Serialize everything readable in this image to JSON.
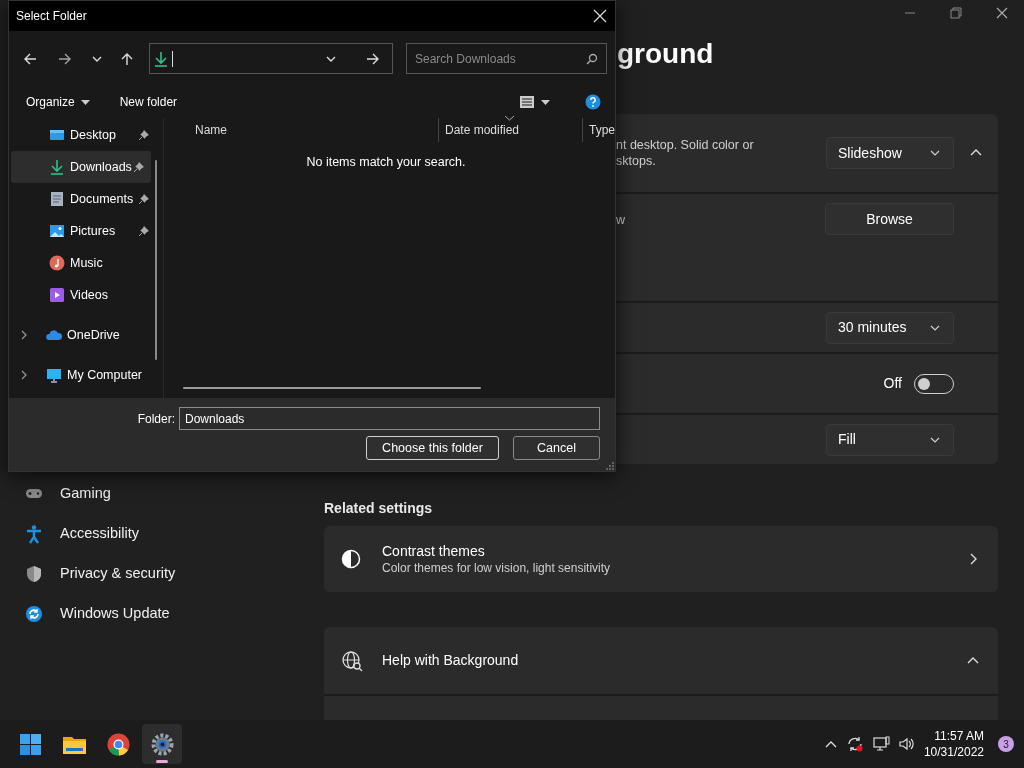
{
  "settings": {
    "heading": "ground",
    "sidebar": [
      {
        "label": "Gaming"
      },
      {
        "label": "Accessibility"
      },
      {
        "label": "Privacy & security"
      },
      {
        "label": "Windows Update"
      }
    ],
    "background_card": {
      "rows": [
        {
          "kind": "dropdown",
          "description_lines": [
            "nt desktop. Solid color or",
            "sktops."
          ],
          "value": "Slideshow",
          "expanded": true
        },
        {
          "kind": "button",
          "description_lines": [
            "w"
          ],
          "value": "Browse"
        },
        {
          "kind": "dropdown",
          "value": "30 minutes"
        },
        {
          "kind": "toggle",
          "on": false,
          "value": "Off"
        },
        {
          "kind": "dropdown",
          "value": "Fill"
        }
      ]
    },
    "related_settings": {
      "title": "Related settings",
      "items": [
        {
          "title": "Contrast themes",
          "subtitle": "Color themes for low vision, light sensitivity"
        }
      ]
    },
    "help": {
      "title": "Help with Background",
      "expanded": true
    }
  },
  "dialog": {
    "title": "Select Folder",
    "search": {
      "placeholder": "Search Downloads"
    },
    "commands": [
      "Organize",
      "New folder"
    ],
    "nav": [
      {
        "label": "Desktop",
        "kind": "quick",
        "pinned": true,
        "selected": false
      },
      {
        "label": "Downloads",
        "kind": "quick",
        "pinned": true,
        "selected": true
      },
      {
        "label": "Documents",
        "kind": "quick",
        "pinned": true,
        "selected": false
      },
      {
        "label": "Pictures",
        "kind": "quick",
        "pinned": true,
        "selected": false
      },
      {
        "label": "Music",
        "kind": "quick",
        "pinned": false,
        "selected": false
      },
      {
        "label": "Videos",
        "kind": "quick",
        "pinned": false,
        "selected": false
      },
      {
        "label": "OneDrive",
        "kind": "location",
        "pinned": false,
        "selected": false
      },
      {
        "label": "My Computer",
        "kind": "location",
        "pinned": false,
        "selected": false
      }
    ],
    "columns": [
      {
        "label": "Name",
        "sorted": false
      },
      {
        "label": "Date modified",
        "sorted": true
      },
      {
        "label": "Type",
        "sorted": false
      }
    ],
    "empty_message": "No items match your search.",
    "folder_label": "Folder:",
    "folder_value": "Downloads",
    "buttons": [
      "Choose this folder",
      "Cancel"
    ]
  },
  "taskbar": {
    "apps": [
      {
        "selected": false
      },
      {
        "selected": false
      },
      {
        "selected": false
      },
      {
        "selected": true
      }
    ],
    "time": "11:57 AM",
    "date": "10/31/2022",
    "badge": "3"
  }
}
